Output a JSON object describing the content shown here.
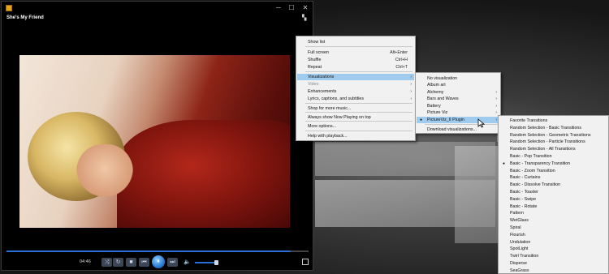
{
  "player": {
    "track_title": "She's My Friend",
    "time": "04:46",
    "window_buttons": {
      "minimize": "─",
      "maximize": "☐",
      "close": "✕"
    },
    "switch_to_library_icon": "grid-icon",
    "controls": {
      "shuffle": "⤨",
      "repeat": "↻",
      "stop": "■",
      "previous": "⏮",
      "play_pause": "⏸",
      "next": "⏭",
      "volume": "🔈"
    },
    "accent_color": "#2a6fd6"
  },
  "context_menu": {
    "items": [
      {
        "label": "Show list",
        "shortcut": ""
      },
      {
        "label": "Full screen",
        "shortcut": "Alt+Enter"
      },
      {
        "label": "Shuffle",
        "shortcut": "Ctrl+H"
      },
      {
        "label": "Repeat",
        "shortcut": "Ctrl+T"
      },
      {
        "label": "Visualizations",
        "shortcut": "",
        "submenu": true,
        "highlighted": true
      },
      {
        "label": "Video",
        "shortcut": "",
        "submenu": true,
        "disabled": true
      },
      {
        "label": "Enhancements",
        "shortcut": "",
        "submenu": true
      },
      {
        "label": "Lyrics, captions, and subtitles",
        "shortcut": "",
        "submenu": true
      },
      {
        "label": "Shop for more music...",
        "shortcut": ""
      },
      {
        "label": "Always show Now Playing on top",
        "shortcut": ""
      },
      {
        "label": "More options...",
        "shortcut": ""
      },
      {
        "label": "Help with playback...",
        "shortcut": ""
      }
    ]
  },
  "visualizations_menu": {
    "items": [
      {
        "label": "No visualization"
      },
      {
        "label": "Album art"
      },
      {
        "label": "Alchemy",
        "submenu": true
      },
      {
        "label": "Bars and Waves",
        "submenu": true
      },
      {
        "label": "Battery",
        "submenu": true
      },
      {
        "label": "Picture Viz",
        "submenu": true
      },
      {
        "label": "PictureViz_II Plugin",
        "submenu": true,
        "selected": true,
        "highlighted": true
      },
      {
        "label": "Download visualizations..."
      }
    ]
  },
  "pictureviz_menu": {
    "items": [
      "Favorite Transitions",
      "Random Selection - Basic Transitions",
      "Random Selection - Geometric Transitions",
      "Random Selection - Particle Transitions",
      "Random Selection - All Transitions",
      "Basic - Pop Transition",
      "Basic - Transparency Transition",
      "Basic - Zoom Transition",
      "Basic - Curtains",
      "Basic - Dissolve Transition",
      "Basic - Toaster",
      "Basic - Swipe",
      "Basic - Rotate",
      "Pattern",
      "WetGlass",
      "Spiral",
      "Flourish",
      "Undulation",
      "SpotLight",
      "Twirl Transition",
      "Disperse",
      "SeaGrass"
    ],
    "selected_index": 6
  }
}
